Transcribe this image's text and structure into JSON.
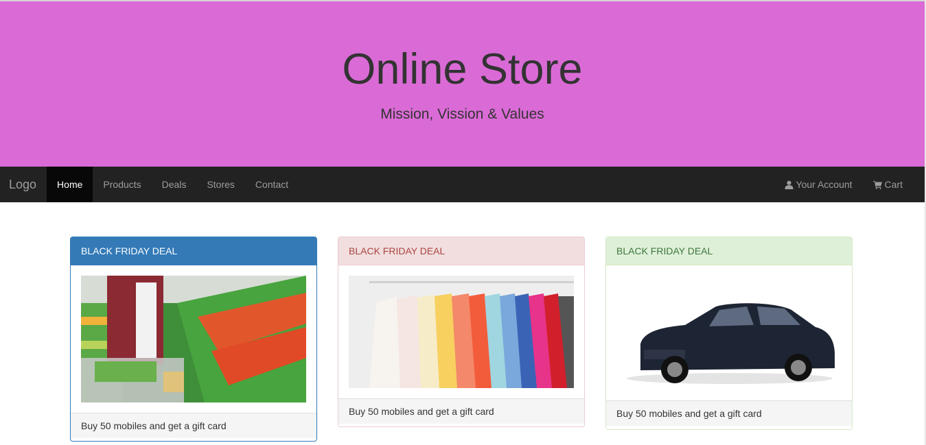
{
  "jumbotron": {
    "title": "Online Store",
    "subtitle": "Mission, Vission & Values",
    "background": "#da6bd6"
  },
  "navbar": {
    "brand": "Logo",
    "items": [
      {
        "label": "Home",
        "active": true
      },
      {
        "label": "Products"
      },
      {
        "label": "Deals"
      },
      {
        "label": "Stores"
      },
      {
        "label": "Contact"
      }
    ],
    "right": [
      {
        "label": "Your Account",
        "icon": "user-icon"
      },
      {
        "label": "Cart",
        "icon": "shopping-cart-icon"
      }
    ]
  },
  "panels": [
    {
      "heading": "BLACK FRIDAY DEAL",
      "footer": "Buy 50 mobiles and get a gift card",
      "style": "primary",
      "image": "grocery-shopping-image"
    },
    {
      "heading": "BLACK FRIDAY DEAL",
      "footer": "Buy 50 mobiles and get a gift card",
      "style": "danger",
      "image": "clothes-rack-image"
    },
    {
      "heading": "BLACK FRIDAY DEAL",
      "footer": "Buy 50 mobiles and get a gift card",
      "style": "success",
      "image": "car-image"
    }
  ]
}
